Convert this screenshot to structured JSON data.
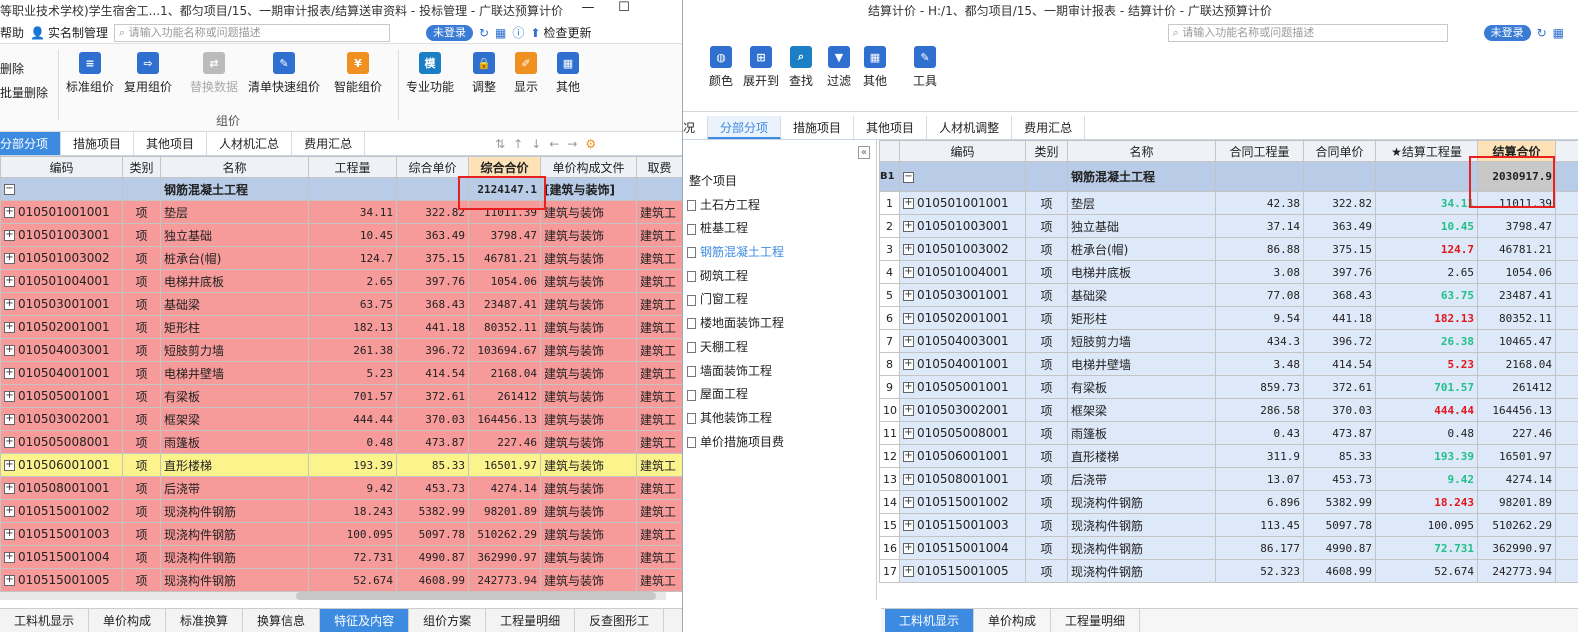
{
  "left": {
    "title": "等职业技术学校)学生宿舍工...1、都匀项目/15、一期审计报表/结算送审资料 - 投标管理 - 广联达预算计价",
    "menu": {
      "help": "帮助",
      "realname": "实名制管理",
      "search_placeholder": "请输入功能名称或问题描述",
      "login": "未登录",
      "check_update": "检查更新"
    },
    "ribbon": {
      "delete": "删除",
      "batch_delete": "批量删除",
      "std_price": "标准组价",
      "reuse_price": "复用组价",
      "replace_data": "替换数据",
      "fast_price": "清单快速组价",
      "smart_price": "智能组价",
      "group_label": "组价",
      "pro_func": "专业功能",
      "adjust": "调整",
      "display": "显示",
      "other": "其他"
    },
    "tabs": [
      "分部分项",
      "措施项目",
      "其他项目",
      "人材机汇总",
      "费用汇总"
    ],
    "columns": [
      "编码",
      "类别",
      "名称",
      "工程量",
      "综合单价",
      "综合合价",
      "单价构成文件",
      "取费"
    ],
    "header_row": {
      "name": "钢筋混凝土工程",
      "total": "2124147.1",
      "file": "[建筑与装饰]"
    },
    "rows": [
      [
        "010501001001",
        "项",
        "垫层",
        "34.11",
        "322.82",
        "11011.39",
        "建筑与装饰",
        "建筑工"
      ],
      [
        "010501003001",
        "项",
        "独立基础",
        "10.45",
        "363.49",
        "3798.47",
        "建筑与装饰",
        "建筑工"
      ],
      [
        "010501003002",
        "项",
        "桩承台(帽)",
        "124.7",
        "375.15",
        "46781.21",
        "建筑与装饰",
        "建筑工"
      ],
      [
        "010501004001",
        "项",
        "电梯井底板",
        "2.65",
        "397.76",
        "1054.06",
        "建筑与装饰",
        "建筑工"
      ],
      [
        "010503001001",
        "项",
        "基础梁",
        "63.75",
        "368.43",
        "23487.41",
        "建筑与装饰",
        "建筑工"
      ],
      [
        "010502001001",
        "项",
        "矩形柱",
        "182.13",
        "441.18",
        "80352.11",
        "建筑与装饰",
        "建筑工"
      ],
      [
        "010504003001",
        "项",
        "短肢剪力墙",
        "261.38",
        "396.72",
        "103694.67",
        "建筑与装饰",
        "建筑工"
      ],
      [
        "010504001001",
        "项",
        "电梯井壁墙",
        "5.23",
        "414.54",
        "2168.04",
        "建筑与装饰",
        "建筑工"
      ],
      [
        "010505001001",
        "项",
        "有梁板",
        "701.57",
        "372.61",
        "261412",
        "建筑与装饰",
        "建筑工"
      ],
      [
        "010503002001",
        "项",
        "框架梁",
        "444.44",
        "370.03",
        "164456.13",
        "建筑与装饰",
        "建筑工"
      ],
      [
        "010505008001",
        "项",
        "雨篷板",
        "0.48",
        "473.87",
        "227.46",
        "建筑与装饰",
        "建筑工"
      ],
      [
        "010506001001",
        "项",
        "直形楼梯",
        "193.39",
        "85.33",
        "16501.97",
        "建筑与装饰",
        "建筑工"
      ],
      [
        "010508001001",
        "项",
        "后浇带",
        "9.42",
        "453.73",
        "4274.14",
        "建筑与装饰",
        "建筑工"
      ],
      [
        "010515001002",
        "项",
        "现浇构件钢筋",
        "18.243",
        "5382.99",
        "98201.89",
        "建筑与装饰",
        "建筑工"
      ],
      [
        "010515001003",
        "项",
        "现浇构件钢筋",
        "100.095",
        "5097.78",
        "510262.29",
        "建筑与装饰",
        "建筑工"
      ],
      [
        "010515001004",
        "项",
        "现浇构件钢筋",
        "72.731",
        "4990.87",
        "362990.97",
        "建筑与装饰",
        "建筑工"
      ],
      [
        "010515001005",
        "项",
        "现浇构件钢筋",
        "52.674",
        "4608.99",
        "242773.94",
        "建筑与装饰",
        "建筑工"
      ]
    ],
    "bottom_tabs": [
      "工料机显示",
      "单价构成",
      "标准换算",
      "换算信息",
      "特征及内容",
      "组价方案",
      "工程量明细",
      "反查图形工"
    ],
    "colors": {
      "row_red": "#f79a9a",
      "row_yellow": "#fdf38c",
      "accent": "#3d8be0"
    }
  },
  "right": {
    "title": "结算计价 - H:/1、都匀项目/15、一期审计报表 - 结算计价 - 广联达预算计价",
    "menu": {
      "search_placeholder": "请输入功能名称或问题描述",
      "login": "未登录"
    },
    "ribbon": {
      "color": "颜色",
      "expand": "展开到",
      "find": "查找",
      "filter": "过滤",
      "other": "其他",
      "tools": "工具"
    },
    "tabs": [
      "况",
      "分部分项",
      "措施项目",
      "其他项目",
      "人材机调整",
      "费用汇总"
    ],
    "tree": [
      "整个项目",
      "土石方工程",
      "桩基工程",
      "钢筋混凝土工程",
      "砌筑工程",
      "门窗工程",
      "楼地面装饰工程",
      "天棚工程",
      "墙面装饰工程",
      "屋面工程",
      "其他装饰工程",
      "单价措施项目费"
    ],
    "columns": [
      "编码",
      "类别",
      "名称",
      "合同工程量",
      "合同单价",
      "★结算工程量",
      "结算合价"
    ],
    "header_row": {
      "code": "B1",
      "name": "钢筋混凝土工程",
      "total": "2030917.9"
    },
    "rows": [
      [
        "1",
        "010501001001",
        "项",
        "垫层",
        "42.38",
        "322.82",
        "34.11",
        "11011.39",
        "green"
      ],
      [
        "2",
        "010501003001",
        "项",
        "独立基础",
        "37.14",
        "363.49",
        "10.45",
        "3798.47",
        "green"
      ],
      [
        "3",
        "010501003002",
        "项",
        "桩承台(帽)",
        "86.88",
        "375.15",
        "124.7",
        "46781.21",
        "red"
      ],
      [
        "4",
        "010501004001",
        "项",
        "电梯井底板",
        "3.08",
        "397.76",
        "2.65",
        "1054.06",
        ""
      ],
      [
        "5",
        "010503001001",
        "项",
        "基础梁",
        "77.08",
        "368.43",
        "63.75",
        "23487.41",
        "green"
      ],
      [
        "6",
        "010502001001",
        "项",
        "矩形柱",
        "9.54",
        "441.18",
        "182.13",
        "80352.11",
        "red"
      ],
      [
        "7",
        "010504003001",
        "项",
        "短肢剪力墙",
        "434.3",
        "396.72",
        "26.38",
        "10465.47",
        "green"
      ],
      [
        "8",
        "010504001001",
        "项",
        "电梯井壁墙",
        "3.48",
        "414.54",
        "5.23",
        "2168.04",
        "red"
      ],
      [
        "9",
        "010505001001",
        "项",
        "有梁板",
        "859.73",
        "372.61",
        "701.57",
        "261412",
        "green"
      ],
      [
        "10",
        "010503002001",
        "项",
        "框架梁",
        "286.58",
        "370.03",
        "444.44",
        "164456.13",
        "red"
      ],
      [
        "11",
        "010505008001",
        "项",
        "雨篷板",
        "0.43",
        "473.87",
        "0.48",
        "227.46",
        ""
      ],
      [
        "12",
        "010506001001",
        "项",
        "直形楼梯",
        "311.9",
        "85.33",
        "193.39",
        "16501.97",
        "green"
      ],
      [
        "13",
        "010508001001",
        "项",
        "后浇带",
        "13.07",
        "453.73",
        "9.42",
        "4274.14",
        "green"
      ],
      [
        "14",
        "010515001002",
        "项",
        "现浇构件钢筋",
        "6.896",
        "5382.99",
        "18.243",
        "98201.89",
        "red"
      ],
      [
        "15",
        "010515001003",
        "项",
        "现浇构件钢筋",
        "113.45",
        "5097.78",
        "100.095",
        "510262.29",
        ""
      ],
      [
        "16",
        "010515001004",
        "项",
        "现浇构件钢筋",
        "86.177",
        "4990.87",
        "72.731",
        "362990.97",
        "green"
      ],
      [
        "17",
        "010515001005",
        "项",
        "现浇构件钢筋",
        "52.323",
        "4608.99",
        "52.674",
        "242773.94",
        ""
      ]
    ],
    "bottom_tabs": [
      "工料机显示",
      "单价构成",
      "工程量明细"
    ],
    "colors": {
      "row_blue": "#dde8f8",
      "header_row": "#b8cce8",
      "green": "#22c08a",
      "red": "#e4161d"
    }
  }
}
